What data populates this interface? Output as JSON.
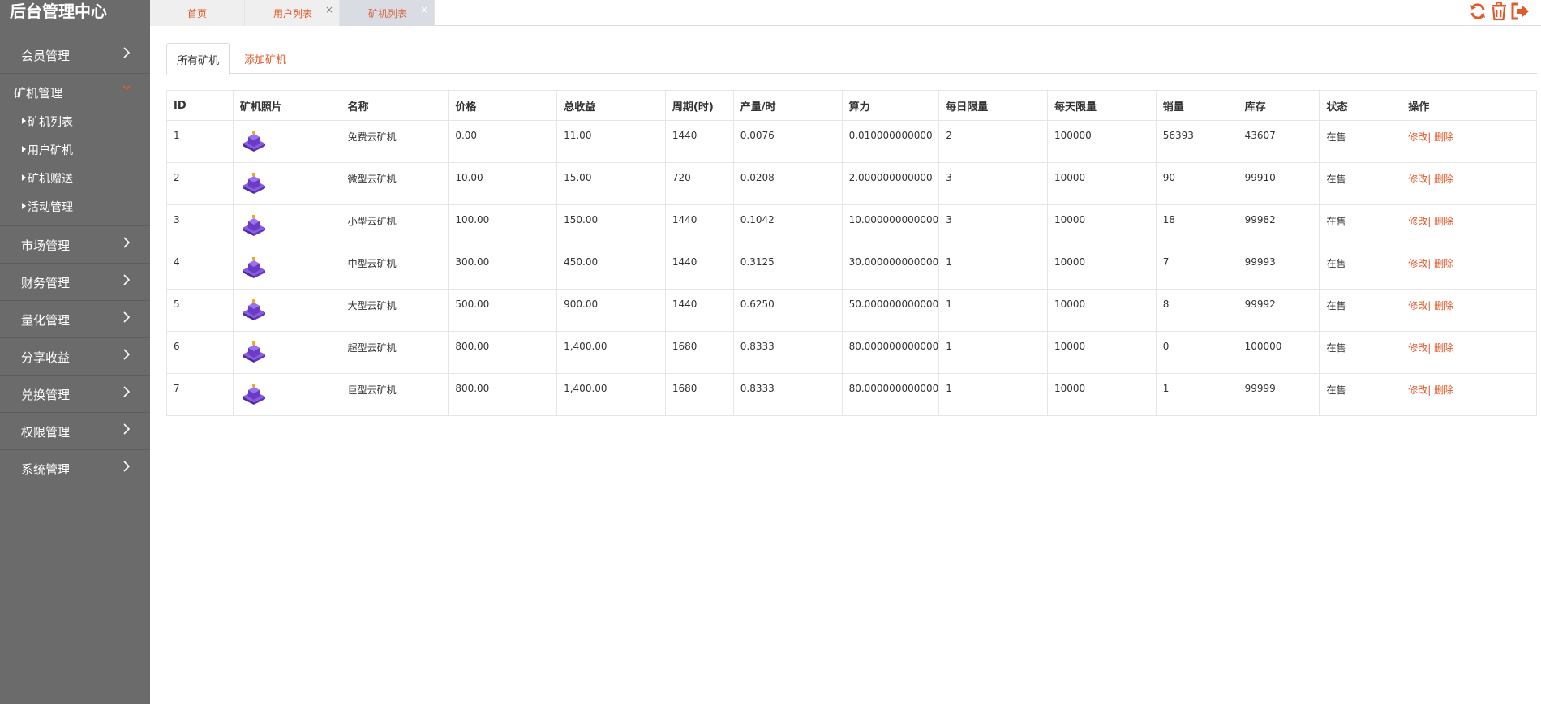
{
  "app": {
    "title": "后台管理中心"
  },
  "sidebar": {
    "items": [
      {
        "label": "会员管理"
      },
      {
        "label": "矿机管理",
        "open": true,
        "children": [
          {
            "label": "矿机列表"
          },
          {
            "label": "用户矿机"
          },
          {
            "label": "矿机赠送"
          },
          {
            "label": "活动管理"
          }
        ]
      },
      {
        "label": "市场管理"
      },
      {
        "label": "财务管理"
      },
      {
        "label": "量化管理"
      },
      {
        "label": "分享收益"
      },
      {
        "label": "兑换管理"
      },
      {
        "label": "权限管理"
      },
      {
        "label": "系统管理"
      }
    ]
  },
  "tabs": [
    {
      "label": "首页",
      "closable": false
    },
    {
      "label": "用户列表",
      "closable": true,
      "close": "×"
    },
    {
      "label": "矿机列表",
      "closable": true,
      "close": "×",
      "active": true
    }
  ],
  "top_icons": [
    "refresh-icon",
    "trash-icon",
    "logout-icon"
  ],
  "subtabs": {
    "all": "所有矿机",
    "add": "添加矿机"
  },
  "table": {
    "columns": [
      "ID",
      "矿机照片",
      "名称",
      "价格",
      "总收益",
      "周期(时)",
      "产量/时",
      "算力",
      "每日限量",
      "每天限量",
      "销量",
      "库存",
      "状态",
      "操作"
    ],
    "rows": [
      {
        "id": "1",
        "name": "免费云矿机",
        "price": "0.00",
        "total": "11.00",
        "cycle": "1440",
        "output": "0.0076",
        "power": "0.010000000000",
        "daily": "2",
        "per_day": "100000",
        "sales": "56393",
        "stock": "43607",
        "status": "在售"
      },
      {
        "id": "2",
        "name": "微型云矿机",
        "price": "10.00",
        "total": "15.00",
        "cycle": "720",
        "output": "0.0208",
        "power": "2.000000000000",
        "daily": "3",
        "per_day": "10000",
        "sales": "90",
        "stock": "99910",
        "status": "在售"
      },
      {
        "id": "3",
        "name": "小型云矿机",
        "price": "100.00",
        "total": "150.00",
        "cycle": "1440",
        "output": "0.1042",
        "power": "10.000000000000",
        "daily": "3",
        "per_day": "10000",
        "sales": "18",
        "stock": "99982",
        "status": "在售"
      },
      {
        "id": "4",
        "name": "中型云矿机",
        "price": "300.00",
        "total": "450.00",
        "cycle": "1440",
        "output": "0.3125",
        "power": "30.000000000000",
        "daily": "1",
        "per_day": "10000",
        "sales": "7",
        "stock": "99993",
        "status": "在售"
      },
      {
        "id": "5",
        "name": "大型云矿机",
        "price": "500.00",
        "total": "900.00",
        "cycle": "1440",
        "output": "0.6250",
        "power": "50.000000000000",
        "daily": "1",
        "per_day": "10000",
        "sales": "8",
        "stock": "99992",
        "status": "在售"
      },
      {
        "id": "6",
        "name": "超型云矿机",
        "price": "800.00",
        "total": "1,400.00",
        "cycle": "1680",
        "output": "0.8333",
        "power": "80.000000000000",
        "daily": "1",
        "per_day": "10000",
        "sales": "0",
        "stock": "100000",
        "status": "在售"
      },
      {
        "id": "7",
        "name": "巨型云矿机",
        "price": "800.00",
        "total": "1,400.00",
        "cycle": "1680",
        "output": "0.8333",
        "power": "80.000000000000",
        "daily": "1",
        "per_day": "10000",
        "sales": "1",
        "stock": "99999",
        "status": "在售"
      }
    ],
    "actions": {
      "edit": "修改",
      "sep": "|",
      "delete": "删除"
    }
  },
  "colors": {
    "accent": "#e05a2b",
    "sidebar_bg": "#6b6b6b",
    "machine_purple": "#6a3bc4"
  }
}
